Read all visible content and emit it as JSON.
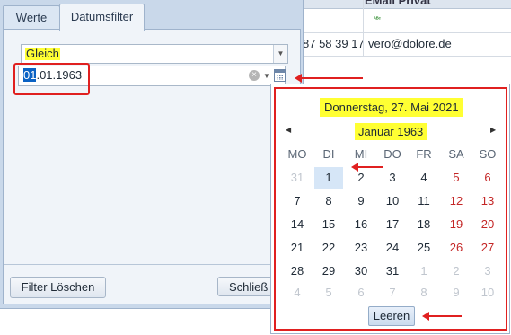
{
  "grid": {
    "header_text": "EMail Privat",
    "phone_fragment": "87 58 39 17",
    "email": "vero@dolore.de",
    "abc_icon": "abc-text-icon"
  },
  "filter": {
    "tabs": [
      "Werte",
      "Datumsfilter"
    ],
    "active_tab": "Datumsfilter",
    "operator_value": "Gleich",
    "date_value_selected": "01",
    "date_value_rest": ".01.1963",
    "clear_button": "Filter Löschen",
    "close_button": "Schließ"
  },
  "calendar": {
    "today_label": "Donnerstag, 27. Mai 2021",
    "month_label": "Januar 1963",
    "weekdays": [
      "MO",
      "DI",
      "MI",
      "DO",
      "FR",
      "SA",
      "SO"
    ],
    "weeks": [
      [
        "31",
        "1",
        "2",
        "3",
        "4",
        "5",
        "6"
      ],
      [
        "7",
        "8",
        "9",
        "10",
        "11",
        "12",
        "13"
      ],
      [
        "14",
        "15",
        "16",
        "17",
        "18",
        "19",
        "20"
      ],
      [
        "21",
        "22",
        "23",
        "24",
        "25",
        "26",
        "27"
      ],
      [
        "28",
        "29",
        "30",
        "31",
        "1",
        "2",
        "3"
      ],
      [
        "4",
        "5",
        "6",
        "7",
        "8",
        "9",
        "10"
      ]
    ],
    "selected_day": "1",
    "clear_label": "Leeren"
  },
  "colors": {
    "highlight": "#ffff33",
    "annotation_red": "#e02020",
    "panel_bg": "#c9d8ea"
  }
}
